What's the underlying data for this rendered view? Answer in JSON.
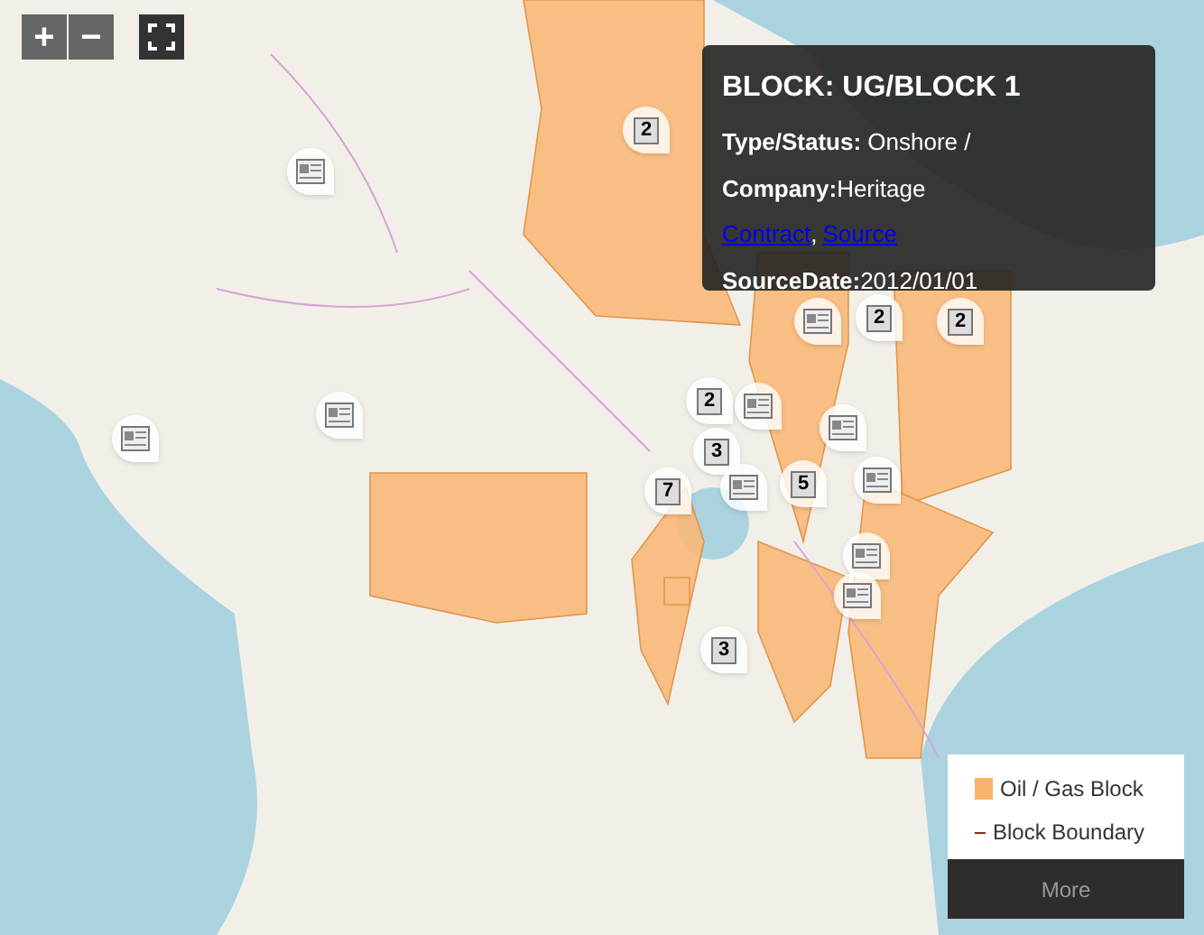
{
  "zoom_controls": {
    "zoom_in": "+",
    "zoom_out": "−"
  },
  "map": {
    "markers": [
      {
        "kind": "cluster",
        "count": "2"
      },
      {
        "kind": "document"
      },
      {
        "kind": "document"
      },
      {
        "kind": "document"
      },
      {
        "kind": "cluster",
        "count": "2"
      },
      {
        "kind": "cluster",
        "count": "3"
      },
      {
        "kind": "cluster",
        "count": "7"
      },
      {
        "kind": "document"
      },
      {
        "kind": "cluster",
        "count": "5"
      },
      {
        "kind": "document"
      },
      {
        "kind": "document"
      },
      {
        "kind": "document"
      },
      {
        "kind": "document"
      },
      {
        "kind": "document"
      },
      {
        "kind": "cluster",
        "count": "3"
      },
      {
        "kind": "document"
      },
      {
        "kind": "cluster",
        "count": "2"
      },
      {
        "kind": "cluster",
        "count": "2"
      }
    ]
  },
  "popup": {
    "title": "BLOCK: UG/BLOCK 1",
    "rows": [
      {
        "label": "Type/Status:",
        "value": " Onshore /"
      },
      {
        "label": "Company:",
        "value": "Heritage"
      }
    ],
    "links": [
      "Contract",
      "Source"
    ],
    "link_separator": ",",
    "source_date": {
      "label": "SourceDate:",
      "value": "2012/01/01"
    }
  },
  "legend": {
    "items": [
      {
        "kind": "swatch",
        "label": "Oil / Gas Block"
      },
      {
        "kind": "line",
        "label": "Block Boundary"
      }
    ],
    "more": "More"
  }
}
